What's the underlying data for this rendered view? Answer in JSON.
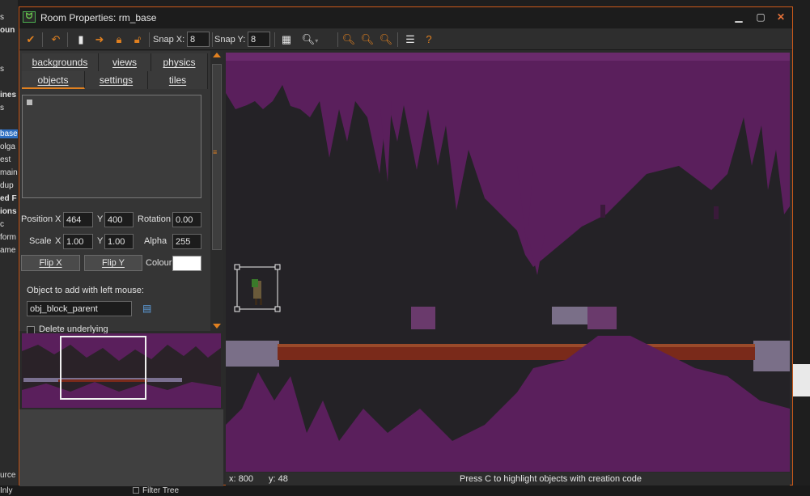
{
  "background_ide": {
    "items": [
      "s",
      "oun",
      "s",
      "ines",
      "s",
      "base",
      "olga",
      "est",
      "main",
      "dup",
      "ed F",
      "ions",
      "c",
      "form",
      "ame"
    ],
    "bottom_items": [
      "urce",
      "Inly"
    ],
    "filter_tree": "Filter Tree"
  },
  "window": {
    "title": "Room Properties: rm_base",
    "minimize": "▁",
    "maximize": "▢",
    "close": "✕"
  },
  "toolbar": {
    "snap_x_label": "Snap X:",
    "snap_x_value": "8",
    "snap_y_label": "Snap Y:",
    "snap_y_value": "8",
    "icons": [
      "confirm-check-icon",
      "undo-icon",
      "new-page-icon",
      "arrow-right-icon",
      "lock-icon",
      "unlock-icon",
      "grid-icon",
      "zoom-dropdown-icon",
      "zoom-out-icon",
      "zoom-reset-icon",
      "zoom-in-icon",
      "list-icon",
      "help-icon"
    ]
  },
  "tabs": {
    "row1": [
      "backgrounds",
      "views",
      "physics"
    ],
    "row2": [
      "objects",
      "settings",
      "tiles"
    ],
    "active": "objects"
  },
  "objects_panel": {
    "position_label": "Position",
    "x_label": "X",
    "y_label": "Y",
    "position_x": "464",
    "position_y": "400",
    "rotation_label": "Rotation",
    "rotation": "0.00",
    "scale_label": "Scale",
    "scale_x": "1.00",
    "scale_y": "1.00",
    "alpha_label": "Alpha",
    "alpha": "255",
    "flip_x": "Flip X",
    "flip_y": "Flip Y",
    "colour_label": "Colour",
    "colour_value": "#ffffff",
    "object_add_label": "Object to add with left mouse:",
    "object_add_value": "obj_block_parent",
    "delete_underlying": "Delete underlying"
  },
  "status": {
    "x": "x: 800",
    "y": "y: 48",
    "message": "Press C to highlight objects with creation code"
  },
  "colors": {
    "accent": "#e08020",
    "window_border": "#cc5a1a",
    "cave_purple": "#5a1f5c",
    "floor_red": "#7a2a1a"
  }
}
